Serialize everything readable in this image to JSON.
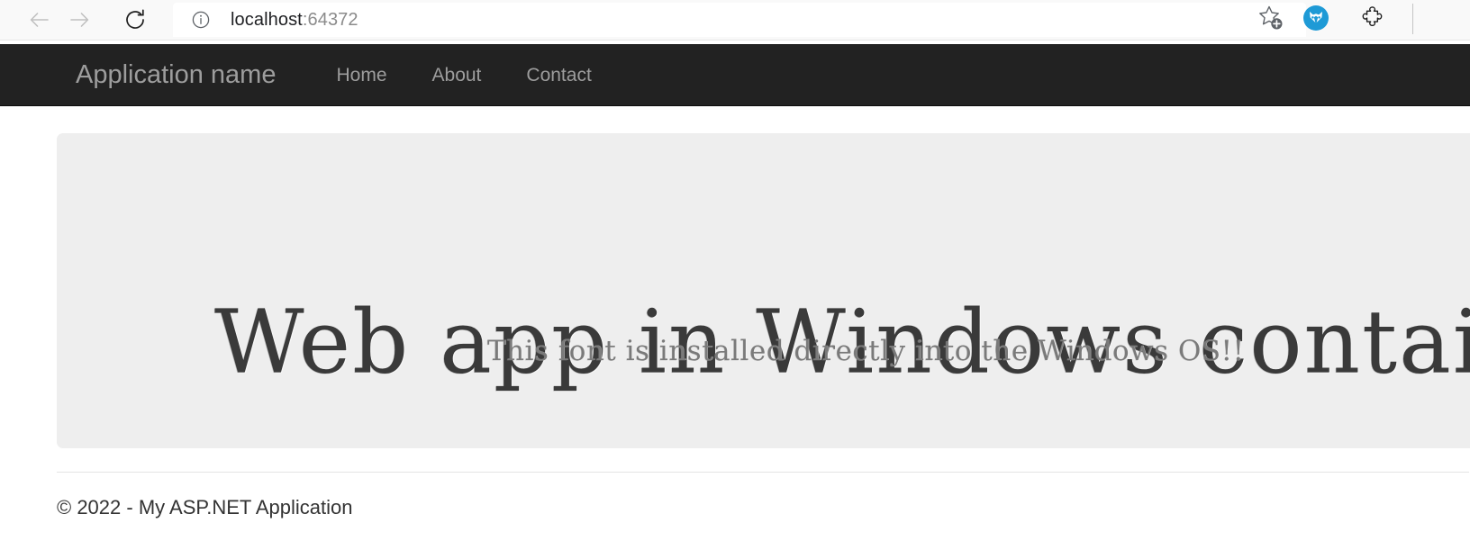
{
  "browser": {
    "back_label": "Back",
    "forward_label": "Forward",
    "reload_label": "Refresh",
    "url_host": "localhost",
    "url_port": ":64372",
    "site_info_label": "View site information",
    "favorite_label": "Add this page to favorites",
    "extension_label": "Extension",
    "puzzle_label": "Extensions",
    "icons": {
      "back": "arrow-left-icon",
      "forward": "arrow-right-icon",
      "reload": "reload-icon",
      "site_info": "info-circle-icon",
      "favorite": "star-plus-icon",
      "extension": "wolf-head-extension-icon",
      "puzzle": "puzzle-piece-icon"
    },
    "colors": {
      "toolbar_bg": "#f9f9f9",
      "url_bar_bg": "#ffffff",
      "extension_blue": "#1e9ad6",
      "disabled_icon": "#c0c0c0",
      "active_icon": "#1f1f1f"
    }
  },
  "navbar": {
    "brand": "Application name",
    "links": [
      {
        "label": "Home"
      },
      {
        "label": "About"
      },
      {
        "label": "Contact"
      }
    ],
    "colors": {
      "bg": "#222222",
      "link": "#9d9d9d"
    }
  },
  "jumbotron": {
    "heading": "Web app in Windows container",
    "subheading": "This font is installed directly into the Windows OS!!",
    "colors": {
      "bg": "#eeeeee",
      "heading": "#3a3a3a",
      "subheading": "#7a7a7a"
    }
  },
  "footer": {
    "copyright": "© 2022 - My ASP.NET Application"
  }
}
